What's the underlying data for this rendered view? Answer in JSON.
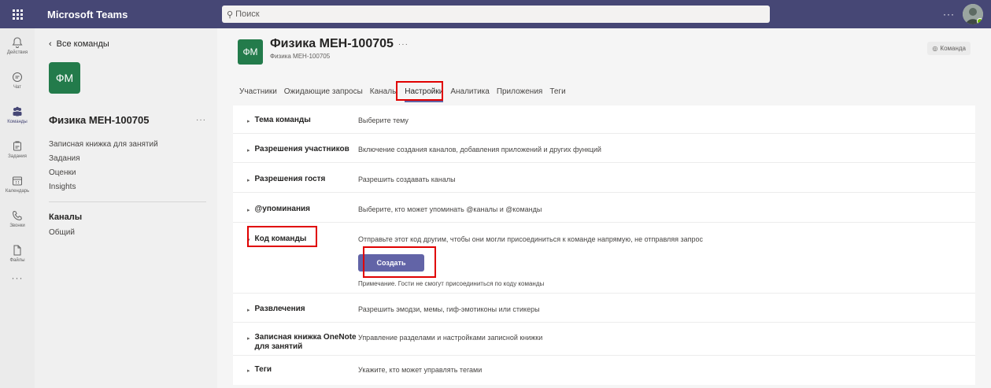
{
  "topbar": {
    "app_title": "Microsoft Teams",
    "search_placeholder": "Поиск",
    "more": "···"
  },
  "rail": {
    "items": [
      {
        "label": "Действия",
        "icon": "bell-icon"
      },
      {
        "label": "Чат",
        "icon": "chat-icon"
      },
      {
        "label": "Команды",
        "icon": "teams-icon"
      },
      {
        "label": "Задания",
        "icon": "assignments-icon"
      },
      {
        "label": "Календарь",
        "icon": "calendar-icon"
      },
      {
        "label": "Звонки",
        "icon": "phone-icon"
      },
      {
        "label": "Файлы",
        "icon": "file-icon"
      }
    ],
    "more": "···"
  },
  "sidebar": {
    "back_label": "Все команды",
    "tile_initials": "ФМ",
    "team_name": "Физика МЕН-100705",
    "more": "···",
    "links": [
      "Записная книжка для занятий",
      "Задания",
      "Оценки",
      "Insights"
    ],
    "channels_header": "Каналы",
    "channels": [
      "Общий"
    ]
  },
  "header": {
    "tile_initials": "ФМ",
    "title": "Физика МЕН-100705",
    "more": "···",
    "subtitle": "Физика МЕН-100705",
    "badge": "Команда"
  },
  "tabs": [
    "Участники",
    "Ожидающие запросы",
    "Каналы",
    "Настройки",
    "Аналитика",
    "Приложения",
    "Теги"
  ],
  "active_tab": "Настройки",
  "settings": {
    "rows": [
      {
        "label": "Тема команды",
        "desc": "Выберите тему"
      },
      {
        "label": "Разрешения участников",
        "desc": "Включение создания каналов, добавления приложений и других функций"
      },
      {
        "label": "Разрешения гостя",
        "desc": "Разрешить создавать каналы"
      },
      {
        "label": "@упоминания",
        "desc": "Выберите, кто может упоминать @каналы и @команды"
      },
      {
        "label": "Код команды",
        "desc": "Отправьте этот код другим, чтобы они могли присоединиться к команде напрямую, не отправляя запрос"
      },
      {
        "label": "Развлечения",
        "desc": "Разрешить эмодзи, мемы, гиф-эмотиконы или стикеры"
      },
      {
        "label": "Записная книжка OneNote для занятий",
        "desc": "Управление разделами и настройками записной книжки"
      },
      {
        "label": "Теги",
        "desc": "Укажите, кто может управлять тегами"
      }
    ],
    "create_button": "Создать",
    "team_code_note": "Примечание. Гости не смогут присоединиться по коду команды"
  },
  "colors": {
    "topbar": "#464775",
    "accent": "#6264a7",
    "team_tile": "#237b4b",
    "highlight": "#e00000"
  }
}
